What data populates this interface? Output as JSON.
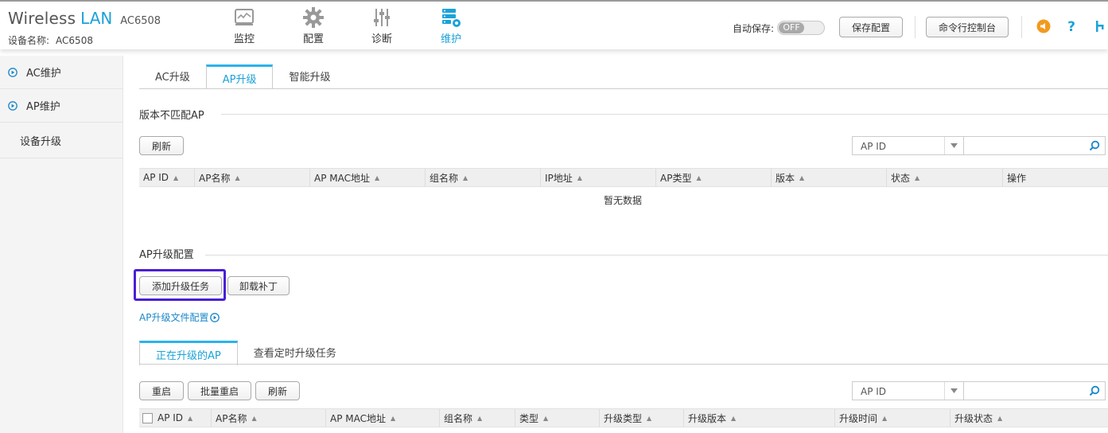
{
  "header": {
    "brand_word1": "Wireless",
    "brand_word2": "LAN",
    "brand_model": "AC6508",
    "device_label": "设备名称:",
    "device_value": "AC6508",
    "nav": [
      {
        "label": "监控",
        "icon": "monitor-icon"
      },
      {
        "label": "配置",
        "icon": "gear-icon"
      },
      {
        "label": "诊断",
        "icon": "sliders-icon"
      },
      {
        "label": "维护",
        "icon": "maintenance-icon",
        "active": true
      }
    ],
    "autosave_label": "自动保存:",
    "autosave_state": "OFF",
    "save_config": "保存配置",
    "cli_console": "命令行控制台",
    "accent": "#1aa3d9"
  },
  "sidebar": {
    "items": [
      {
        "label": "AC维护",
        "icon": "circle-play-icon"
      },
      {
        "label": "AP维护",
        "icon": "circle-play-icon"
      },
      {
        "label": "设备升级"
      }
    ]
  },
  "main": {
    "tabs": [
      {
        "label": "AC升级"
      },
      {
        "label": "AP升级",
        "active": true
      },
      {
        "label": "智能升级"
      }
    ],
    "mismatch": {
      "title": "版本不匹配AP",
      "refresh": "刷新",
      "search_field": "AP ID",
      "search_value": "",
      "columns": [
        "AP ID",
        "AP名称",
        "AP MAC地址",
        "组名称",
        "IP地址",
        "AP类型",
        "版本",
        "状态",
        "操作"
      ],
      "empty_text": "暂无数据"
    },
    "upgrade_config": {
      "title": "AP升级配置",
      "add_task": "添加升级任务",
      "uninstall_patch": "卸载补丁",
      "file_config_link": "AP升级文件配置",
      "highlight_color": "#4a1fd6"
    },
    "upgrading": {
      "tabs": [
        {
          "label": "正在升级的AP",
          "active": true
        },
        {
          "label": "查看定时升级任务"
        }
      ],
      "restart": "重启",
      "batch_restart": "批量重启",
      "refresh": "刷新",
      "search_field": "AP ID",
      "search_value": "",
      "columns": [
        "AP ID",
        "AP名称",
        "AP MAC地址",
        "组名称",
        "类型",
        "升级类型",
        "升级版本",
        "升级时间",
        "升级状态"
      ]
    }
  }
}
